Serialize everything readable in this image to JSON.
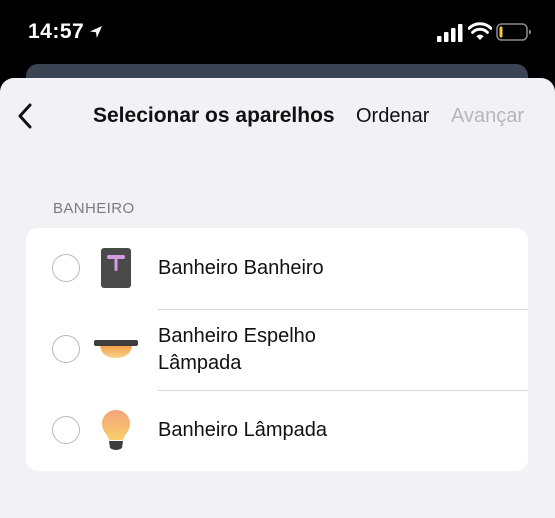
{
  "status_bar": {
    "time": "14:57"
  },
  "nav": {
    "title": "Selecionar os aparelhos",
    "sort_label": "Ordenar",
    "next_label": "Avançar"
  },
  "section": {
    "header": "BANHEIRO",
    "items": [
      {
        "label": "Banheiro Banheiro",
        "icon": "lightstrip-icon",
        "selected": false
      },
      {
        "label": "Banheiro Espelho Lâmpada",
        "icon": "ceiling-light-icon",
        "selected": false
      },
      {
        "label": "Banheiro Lâmpada",
        "icon": "bulb-icon",
        "selected": false
      }
    ]
  }
}
